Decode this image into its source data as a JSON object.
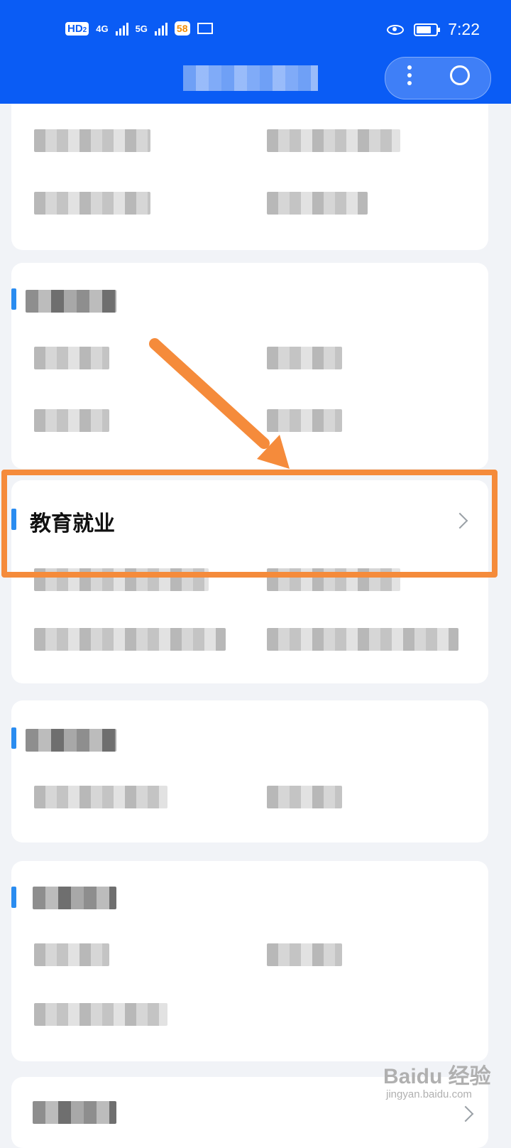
{
  "status_bar": {
    "hd": "HD",
    "hd_sub": "2",
    "net1": "4G",
    "net2": "5G",
    "app_badge": "58",
    "time": "7:22"
  },
  "section": {
    "title": "教育就业"
  },
  "watermark": {
    "brand": "Baidu 经验",
    "url": "jingyan.baidu.com"
  },
  "colors": {
    "header": "#0a5cf5",
    "accent": "#2a8cf0",
    "highlight": "#f58b3b"
  }
}
